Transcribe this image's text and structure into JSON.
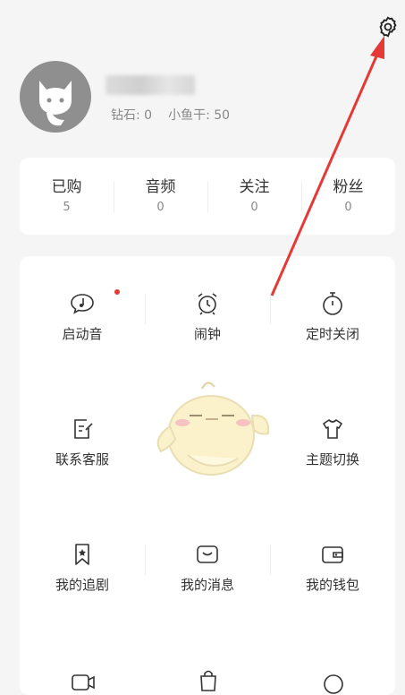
{
  "profile": {
    "diamond_label": "钻石: 0",
    "coin_label": "小鱼干: 50"
  },
  "stats": [
    {
      "label": "已购",
      "value": "5"
    },
    {
      "label": "音频",
      "value": "0"
    },
    {
      "label": "关注",
      "value": "0"
    },
    {
      "label": "粉丝",
      "value": "0"
    }
  ],
  "menu": [
    {
      "label": "启动音",
      "icon": "chat-music-icon",
      "badge": "red-dot"
    },
    {
      "label": "闹钟",
      "icon": "alarm-clock-icon"
    },
    {
      "label": "定时关闭",
      "icon": "timer-icon"
    },
    {
      "label": "联系客服",
      "icon": "edit-note-icon"
    },
    {
      "label": "",
      "icon": ""
    },
    {
      "label": "主题切换",
      "icon": "shirt-icon"
    },
    {
      "label": "我的追剧",
      "icon": "bookmark-icon"
    },
    {
      "label": "我的消息",
      "icon": "message-icon"
    },
    {
      "label": "我的钱包",
      "icon": "wallet-icon"
    }
  ],
  "colors": {
    "accent_red": "#e53935",
    "avatar_bg": "#8f8f8f",
    "page_bg": "#f5f5f5"
  }
}
